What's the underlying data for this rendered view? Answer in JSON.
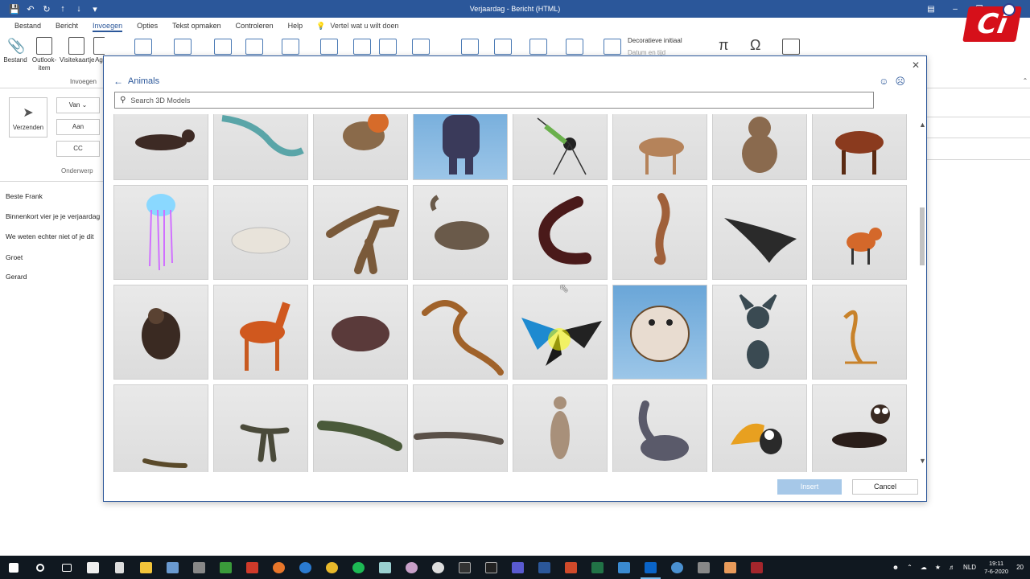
{
  "window": {
    "title": "Verjaardag - Bericht (HTML)"
  },
  "ribbon_tabs": [
    "Bestand",
    "Bericht",
    "Invoegen",
    "Opties",
    "Tekst opmaken",
    "Controleren",
    "Help"
  ],
  "tell_me": "Vertel wat u wilt doen",
  "ribbon": {
    "bestand_label": "Bestand",
    "outlook_item_label": "Outlook-item",
    "visitekaartje_label": "Visitekaartje",
    "ag_label": "Ag",
    "group_invoegen": "Invoegen",
    "decoratieve_initiaal": "Decoratieve initiaal",
    "datum_en_tijd": "Datum en tijd",
    "symbol_pi": "π",
    "symbol_omega": "Ω"
  },
  "compose": {
    "send_label": "Verzenden",
    "van_label": "Van",
    "aan_label": "Aan",
    "cc_label": "CC",
    "onderwerp_label": "Onderwerp",
    "body_lines": [
      "Beste Frank",
      "Binnenkort vier je je verjaardag",
      "We weten echter niet of je dit",
      "Groet",
      "Gerard"
    ]
  },
  "dialog": {
    "back_label": "Animals",
    "search_placeholder": "Search 3D Models",
    "insert_label": "Insert",
    "cancel_label": "Cancel",
    "models": [
      [
        "otter",
        "plesiosaur",
        "robin",
        "gorilla",
        "mosquito",
        "deer",
        "monkey",
        "horse"
      ],
      [
        "jellyfish",
        "shell",
        "t-rex",
        "ankylosaurus",
        "millipede",
        "seahorse",
        "manta-ray",
        "fox"
      ],
      [
        "sloth",
        "horse-orange",
        "hippo",
        "snake",
        "butterfly",
        "bulldog",
        "sphynx-cat",
        "scorpion"
      ],
      [
        "lizard",
        "raptor",
        "crocodile",
        "komodo",
        "meerkat",
        "brachiosaurus",
        "toucan",
        "dachshund"
      ]
    ]
  },
  "taskbar": {
    "language": "NLD",
    "time": "19:11",
    "date": "7-6-2020",
    "notification_count": "20"
  },
  "colors": {
    "accent": "#2b579a",
    "insert_disabled": "#a6c8e8"
  }
}
